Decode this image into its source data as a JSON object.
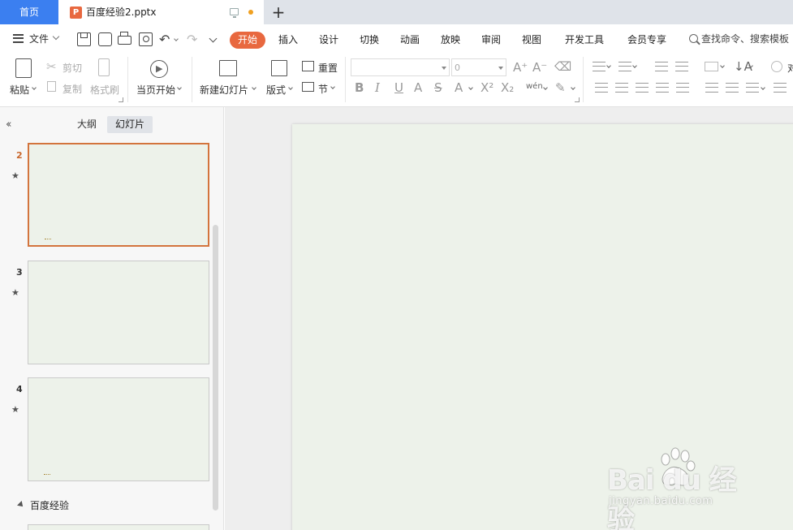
{
  "tabs": {
    "home_label": "首页",
    "document_title": "百度经验2.pptx",
    "add_label": "+"
  },
  "menu": {
    "file_label": "文件",
    "ribbon_tabs": [
      "开始",
      "插入",
      "设计",
      "切换",
      "动画",
      "放映",
      "审阅",
      "视图",
      "开发工具",
      "会员专享"
    ],
    "active_tab": "开始",
    "search_placeholder": "查找命令、搜索模板"
  },
  "ribbon": {
    "paste": "粘贴",
    "cut": "剪切",
    "copy": "复制",
    "format_painter": "格式刷",
    "play_from_current": "当页开始",
    "new_slide": "新建幻灯片",
    "layout": "版式",
    "reset": "重置",
    "section": "节",
    "font_size_value": "0",
    "phonetic_glyph": "wén",
    "partial_right_label": "对"
  },
  "left_pane": {
    "outline_tab": "大纲",
    "slides_tab": "幻灯片",
    "slides": [
      {
        "number": "2",
        "active": true
      },
      {
        "number": "3",
        "active": false
      },
      {
        "number": "4",
        "active": false
      }
    ],
    "section_name": "百度经验"
  },
  "watermark": {
    "brand": "Bai du 经验",
    "url": "jingyan.baidu.com"
  },
  "colors": {
    "accent_orange": "#e8683f",
    "home_tab_blue": "#3b7ff0",
    "slide_background": "#edf2ea"
  }
}
